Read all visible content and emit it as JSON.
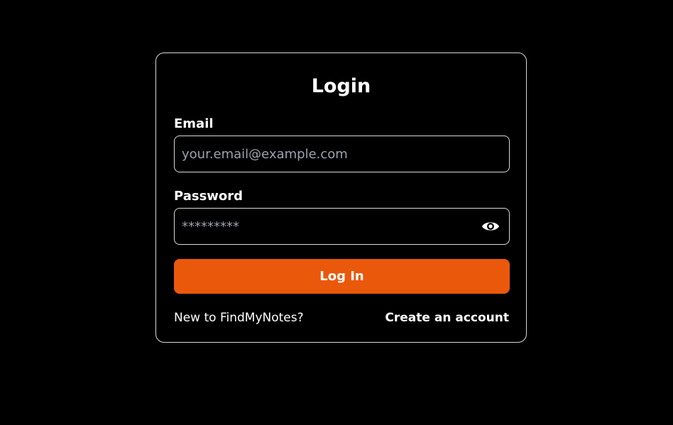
{
  "login": {
    "title": "Login",
    "email_label": "Email",
    "email_placeholder": "your.email@example.com",
    "email_value": "",
    "password_label": "Password",
    "password_placeholder": "*********",
    "password_value": "",
    "password_toggle_icon": "eye-icon",
    "submit_label": "Log In",
    "signup_prompt": "New to FindMyNotes?",
    "signup_link": "Create an account"
  },
  "colors": {
    "background": "#000000",
    "card_border": "#d9d9d9",
    "accent": "#ea580c",
    "text": "#ffffff",
    "placeholder": "#9aa3ad"
  }
}
